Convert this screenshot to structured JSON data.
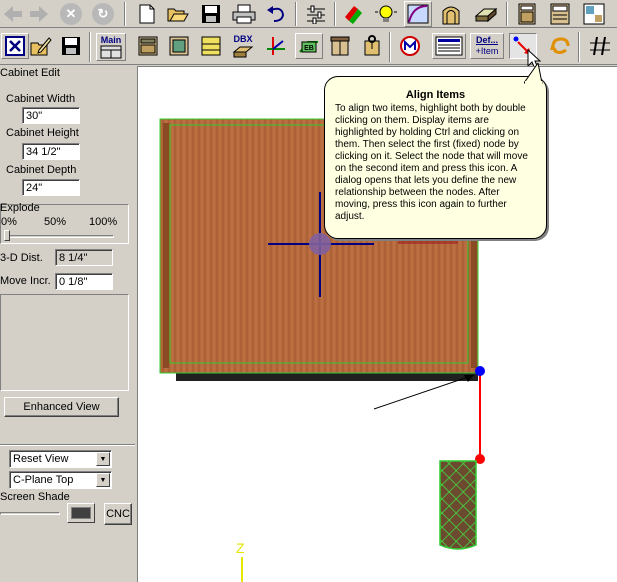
{
  "toolbar_top": {
    "buttons": [
      {
        "icon": "back-arrow-icon"
      },
      {
        "icon": "forward-arrow-icon"
      },
      {
        "icon": "stop-icon"
      },
      {
        "icon": "refresh-icon"
      },
      {
        "icon": "new-document-icon"
      },
      {
        "icon": "open-folder-icon"
      },
      {
        "icon": "save-disk-icon"
      },
      {
        "icon": "print-icon"
      },
      {
        "icon": "undo-icon"
      },
      {
        "icon": "settings-sliders-icon"
      },
      {
        "icon": "material-swatch-icon"
      },
      {
        "icon": "light-bulb-icon"
      },
      {
        "icon": "curve-draw-icon"
      },
      {
        "icon": "arch-door-icon"
      },
      {
        "icon": "panel-3d-icon"
      },
      {
        "icon": "cabinet-icon"
      },
      {
        "icon": "cabinet-list-icon"
      },
      {
        "icon": "layout-icon"
      }
    ]
  },
  "toolbar_second": {
    "main_label": "Main",
    "dbx_label": "DBX",
    "eb_label": "EB",
    "def_label": "Def...",
    "item_label": "+Item"
  },
  "panel": {
    "title": "Cabinet Edit",
    "width_label": "Cabinet Width",
    "width_value": "30\"",
    "height_label": "Cabinet Height",
    "height_value": "34 1/2\"",
    "depth_label": "Cabinet Depth",
    "depth_value": "24\"",
    "explode_label": "Explode",
    "explode_0": "0%",
    "explode_50": "50%",
    "explode_100": "100%",
    "dist_label": "3-D Dist.",
    "dist_value": "8 1/4\"",
    "move_label": "Move Incr.",
    "move_value": "0 1/8\"",
    "enhanced_button": "Enhanced View",
    "reset_view_option": "Reset View",
    "cplane_option": "C-Plane Top",
    "screen_shade_label": "Screen Shade",
    "cnc_button": "CNC"
  },
  "tooltip": {
    "title": "Align Items",
    "body": "To align two items, highlight both by double clicking on them. Display items are highlighted by holding Ctrl and clicking on them. Then select the first (fixed) node by clicking on it. Select the node that will move on the second item and press this icon. A dialog opens that lets you define the new relationship between the nodes. After moving, press this icon again to further adjust."
  },
  "viewport": {
    "axis_label": "Z"
  },
  "colors": {
    "wood": "#b0643a",
    "highlight_green": "#2ecc2e",
    "node_red": "#ff0000",
    "node_blue": "#0000ff",
    "crosshair": "#000080",
    "tooltip_bg": "#ffffe1",
    "axis_yellow": "#e6e600"
  }
}
